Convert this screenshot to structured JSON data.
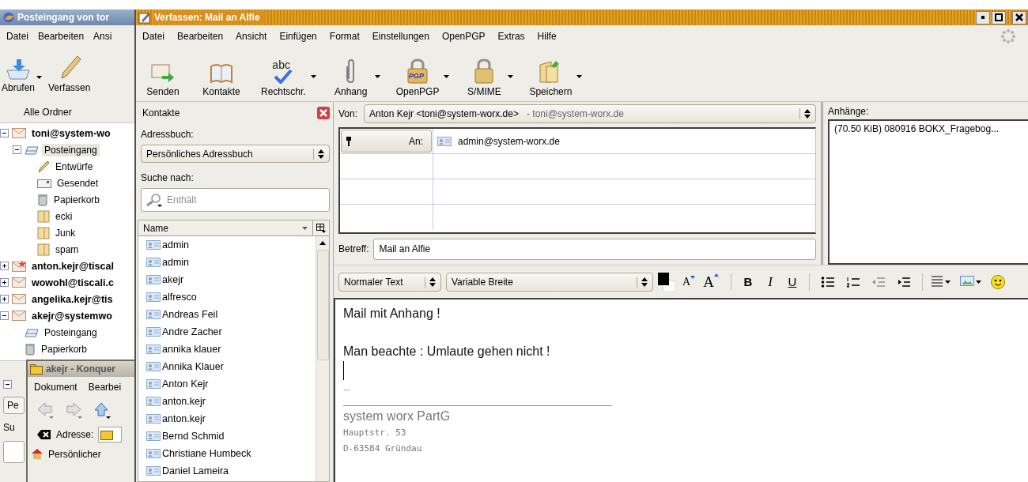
{
  "mail_window": {
    "title": "Posteingang von tor",
    "menu": [
      "Datei",
      "Bearbeiten",
      "Ansi"
    ],
    "toolbar": [
      {
        "label": "Abrufen",
        "kind": "fetch",
        "dropdown": true
      },
      {
        "label": "Verfassen",
        "kind": "write",
        "dropdown": false
      }
    ],
    "folder_pane_title": "Alle Ordner",
    "folders": [
      {
        "label": "toni@system-wo",
        "kind": "account",
        "expanded": true,
        "selected": false,
        "children": [
          {
            "label": "Posteingang",
            "kind": "inbox",
            "expanded": true,
            "selected": true,
            "children": [
              {
                "label": "Entwürfe",
                "kind": "drafts",
                "selected": false
              },
              {
                "label": "Gesendet",
                "kind": "sent",
                "selected": false
              },
              {
                "label": "Papierkorb",
                "kind": "trash",
                "selected": false
              },
              {
                "label": "ecki",
                "kind": "folder",
                "selected": false
              },
              {
                "label": "Junk",
                "kind": "folder",
                "selected": false
              },
              {
                "label": "spam",
                "kind": "folder",
                "selected": false
              }
            ]
          }
        ]
      },
      {
        "label": "anton.kejr@tiscal",
        "kind": "account-new",
        "expanded": false,
        "selected": false
      },
      {
        "label": "wowohl@tiscali.c",
        "kind": "account",
        "expanded": false,
        "selected": false
      },
      {
        "label": "angelika.kejr@tis",
        "kind": "account",
        "expanded": false,
        "selected": false
      },
      {
        "label": "akejr@systemwo",
        "kind": "account",
        "expanded": true,
        "selected": false,
        "children": [
          {
            "label": "Posteingang",
            "kind": "inbox",
            "selected": false
          },
          {
            "label": "Papierkorb",
            "kind": "trash",
            "selected": false
          }
        ]
      }
    ],
    "lower_pane": {
      "addressbook_value": "Pe",
      "search_label": "Su"
    }
  },
  "file_manager_window": {
    "title": "akejr - Konquer",
    "menu": [
      "Dokument",
      "Bearbei"
    ],
    "address_label": "Adresse:",
    "sidebar_item": "Persönlicher"
  },
  "compose_window": {
    "title": "Verfassen: Mail an Alfie",
    "menu": [
      "Datei",
      "Bearbeiten",
      "Ansicht",
      "Einfügen",
      "Format",
      "Einstellungen",
      "OpenPGP",
      "Extras",
      "Hilfe"
    ],
    "toolbar": [
      {
        "label": "Senden",
        "kind": "send",
        "dropdown": false
      },
      {
        "label": "Kontakte",
        "kind": "contacts",
        "dropdown": false
      },
      {
        "label": "Rechtschr.",
        "kind": "spell",
        "icon_text": "abc",
        "dropdown": true
      },
      {
        "label": "Anhang",
        "kind": "attach",
        "dropdown": true
      },
      {
        "label": "OpenPGP",
        "kind": "pgp",
        "icon_text": "PGP",
        "dropdown": true
      },
      {
        "label": "S/MIME",
        "kind": "lock",
        "dropdown": true
      },
      {
        "label": "Speichern",
        "kind": "save",
        "dropdown": true
      }
    ],
    "contacts_panel": {
      "title": "Kontakte",
      "addressbook_label": "Adressbuch:",
      "addressbook": "Persönliches Adressbuch",
      "search_label": "Suche nach:",
      "search_placeholder": "Enthält",
      "column": "Name",
      "contacts": [
        "admin",
        "admin",
        "akejr",
        "alfresco",
        "Andreas Feil",
        "Andre Zacher",
        "annika klauer",
        "Annika Klauer",
        "Anton Kejr",
        "anton.kejr",
        "anton.kejr",
        "Bernd Schmid",
        "Christiane Humbeck",
        "Daniel Lameira"
      ]
    },
    "header": {
      "from_label": "Von:",
      "from": "Anton Kejr <toni@system-worx.de>",
      "from_account": "- toni@system-worx.de",
      "recipients": [
        {
          "type": "An:",
          "address": "admin@system-worx.de"
        }
      ],
      "subject_label": "Betreff:",
      "subject": "Mail an Alfie",
      "attachments_label": "Anhänge:",
      "attachments": [
        "(70.50 KiB) 080916 BOKX_Fragebog..."
      ]
    },
    "format_bar": {
      "paragraph": "Normaler Text",
      "font": "Variable Breite",
      "text_buttons": [
        {
          "kind": "smaller",
          "glyph": "A"
        },
        {
          "kind": "larger",
          "glyph": "A"
        },
        {
          "kind": "bold",
          "glyph": "B"
        },
        {
          "kind": "italic",
          "glyph": "I"
        },
        {
          "kind": "underline",
          "glyph": "U"
        }
      ]
    },
    "body": {
      "lines": [
        "Mail mit Anhang !",
        "Man beachte : Umlaute gehen nicht !"
      ],
      "separator": "--",
      "signature": [
        {
          "kind": "company",
          "text": "system worx PartG"
        },
        {
          "kind": "address",
          "text": "Hauptstr. 53"
        },
        {
          "kind": "address",
          "text": "D-63584 Gründau"
        }
      ]
    }
  }
}
